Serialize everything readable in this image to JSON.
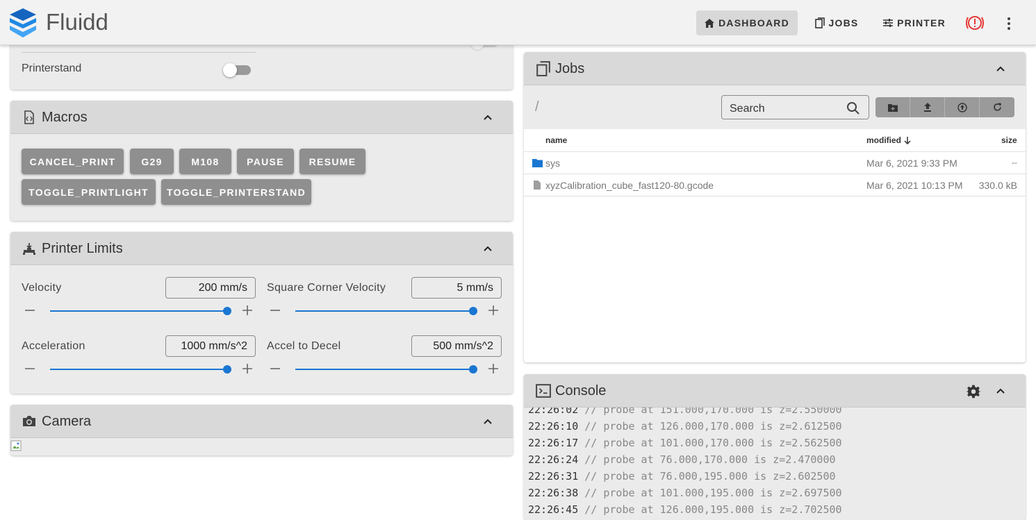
{
  "app": {
    "title": "Fluidd"
  },
  "nav": {
    "dashboard": "DASHBOARD",
    "jobs": "JOBS",
    "printer": "PRINTER"
  },
  "toggles": {
    "printerstand_label": "Printerstand"
  },
  "macros": {
    "title": "Macros",
    "buttons": [
      "CANCEL_PRINT",
      "G29",
      "M108",
      "PAUSE",
      "RESUME",
      "TOGGLE_PRINTLIGHT",
      "TOGGLE_PRINTERSTAND"
    ]
  },
  "limits": {
    "title": "Printer Limits",
    "velocity": {
      "label": "Velocity",
      "value": "200 mm/s",
      "level": 1.0
    },
    "square_corner": {
      "label": "Square Corner Velocity",
      "value": "5 mm/s",
      "level": 1.0
    },
    "acceleration": {
      "label": "Acceleration",
      "value": "1000 mm/s^2",
      "level": 1.0
    },
    "accel_decel": {
      "label": "Accel to Decel",
      "value": "500 mm/s^2",
      "level": 1.0
    }
  },
  "camera": {
    "title": "Camera"
  },
  "jobs": {
    "title": "Jobs",
    "path": "/",
    "search_placeholder": "Search",
    "columns": {
      "name": "name",
      "modified": "modified",
      "size": "size"
    },
    "rows": [
      {
        "type": "folder",
        "name": "sys",
        "modified": "Mar 6, 2021 9:33 PM",
        "size": "--"
      },
      {
        "type": "file",
        "name": "xyzCalibration_cube_fast120-80.gcode",
        "modified": "Mar 6, 2021 10:13 PM",
        "size": "330.0 kB"
      }
    ]
  },
  "console": {
    "title": "Console",
    "lines": [
      {
        "time": "22:26:02",
        "msg": "// probe at 151.000,170.000 is z=2.550000"
      },
      {
        "time": "22:26:10",
        "msg": "// probe at 126.000,170.000 is z=2.612500"
      },
      {
        "time": "22:26:17",
        "msg": "// probe at 101.000,170.000 is z=2.562500"
      },
      {
        "time": "22:26:24",
        "msg": "// probe at 76.000,170.000 is z=2.470000"
      },
      {
        "time": "22:26:31",
        "msg": "// probe at 76.000,195.000 is z=2.602500"
      },
      {
        "time": "22:26:38",
        "msg": "// probe at 101.000,195.000 is z=2.697500"
      },
      {
        "time": "22:26:45",
        "msg": "// probe at 126.000,195.000 is z=2.702500"
      }
    ]
  },
  "colors": {
    "accent": "#1976d2",
    "alert": "#e53935",
    "logo": "#1e88e5"
  }
}
